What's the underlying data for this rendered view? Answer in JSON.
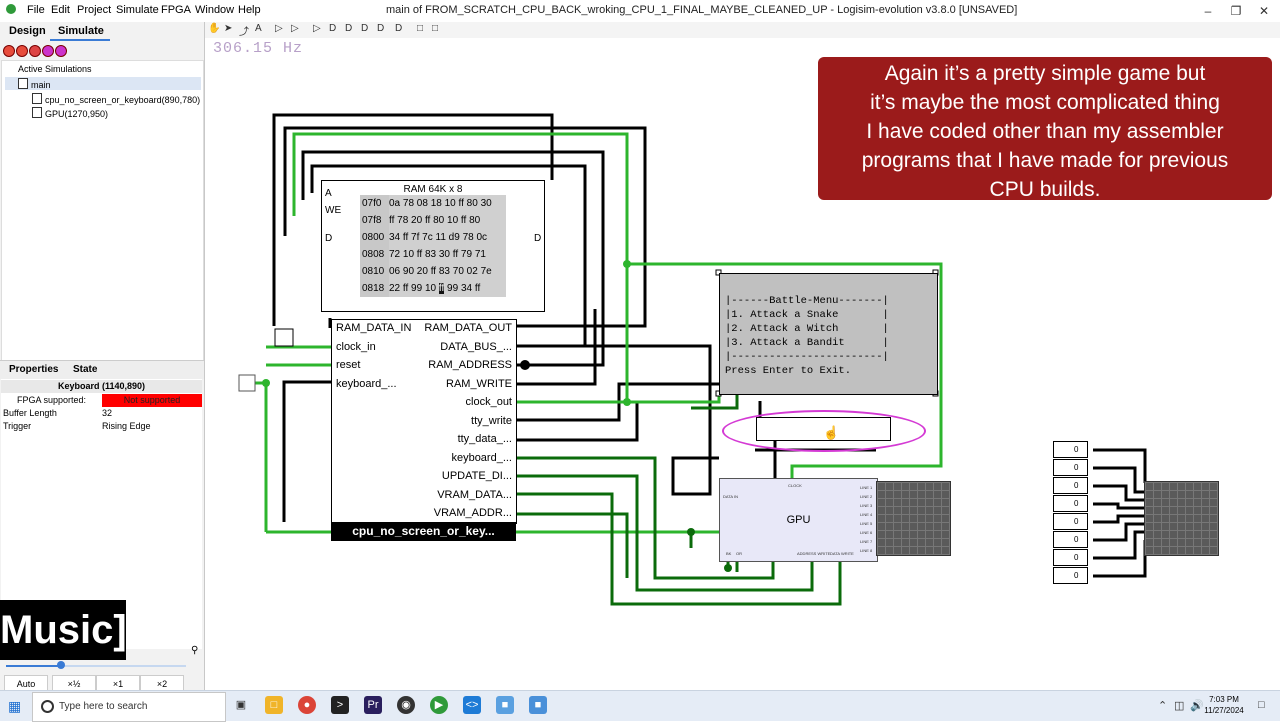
{
  "window": {
    "title": "main of FROM_SCRATCH_CPU_BACK_wroking_CPU_1_FINAL_MAYBE_CLEANED_UP - Logisim-evolution v3.8.0 [UNSAVED]",
    "menus": [
      "File",
      "Edit",
      "Project",
      "Simulate",
      "FPGA",
      "Window",
      "Help"
    ]
  },
  "left": {
    "tabs": [
      "Design",
      "Simulate"
    ],
    "tree_header": "Active Simulations",
    "tree": [
      "main",
      "cpu_no_screen_or_keyboard(890,780)",
      "GPU(1270,950)"
    ],
    "props_tabs": [
      "Properties",
      "State"
    ],
    "props_title": "Keyboard (1140,890)",
    "props": [
      {
        "key": "FPGA supported:",
        "value": "Not supported"
      },
      {
        "key": "Buffer Length",
        "value": "32"
      },
      {
        "key": "Trigger",
        "value": "Rising Edge"
      }
    ],
    "zoom_buttons": [
      "Auto",
      "×½",
      "×1",
      "×2"
    ]
  },
  "overlay": {
    "music": "Music]"
  },
  "canvas": {
    "frequency": "306.15 Hz",
    "caption_lines": [
      "Again it’s a pretty simple game but",
      "it’s maybe the most complicated thing",
      "I have coded other than my assembler",
      "programs that I have made for previous",
      "CPU builds."
    ],
    "ram": {
      "title": "RAM 64K x 8",
      "pin_a": "A",
      "pin_we": "WE",
      "pin_d": "D",
      "pin_d_out": "D",
      "rows": [
        {
          "addr": "07f0",
          "data": "0a 78 08 18 10  ff 80 30"
        },
        {
          "addr": "07f8",
          "data": "ff 78 20  ff 80 10  ff 80"
        },
        {
          "addr": "0800",
          "data": "34  ff 7f 7c 11 d9 78 0c"
        },
        {
          "addr": "0808",
          "data": "72 10  ff 83 30  ff 79 71"
        },
        {
          "addr": "0810",
          "data": "06 90 20  ff 83 70 02 7e"
        },
        {
          "addr": "0818",
          "data": "22  ff 99 10",
          "hl": "ff",
          "rest": "99 34  ff"
        }
      ]
    },
    "cpu": {
      "label": "cpu_no_screen_or_key...",
      "left_pins": [
        "RAM_DATA_IN",
        "clock_in",
        "reset",
        "keyboard_..."
      ],
      "right_pins": [
        "RAM_DATA_OUT",
        "DATA_BUS_...",
        "RAM_ADDRESS",
        "RAM_WRITE",
        "clock_out",
        "tty_write",
        "tty_data_...",
        "keyboard_...",
        "UPDATE_DI...",
        "VRAM_DATA...",
        "VRAM_ADDR..."
      ]
    },
    "tty_lines": [
      "|------Battle-Menu-------|",
      "|1. Attack a Snake       |",
      "|2. Attack a Witch       |",
      "|3. Attack a Bandit      |",
      "|------------------------|",
      "Press Enter to Exit."
    ],
    "gpu": {
      "label": "GPU",
      "pin_clock": "CLOCK",
      "pin_data_in": "DATA IN",
      "pins_bottom": [
        "BK",
        "OR",
        "ADDRESS WRITE",
        "DATA WRITE"
      ],
      "lines": [
        "LINE 1",
        "LINE 2",
        "LINE 3",
        "LINE 4",
        "LINE 5",
        "LINE 6",
        "LINE 7",
        "LINE 8"
      ]
    },
    "output_pins": [
      "0",
      "0",
      "0",
      "0",
      "0",
      "0",
      "0",
      "0"
    ]
  },
  "taskbar": {
    "search_placeholder": "Type here to search",
    "time": "7:03 PM",
    "date": "11/27/2024"
  }
}
